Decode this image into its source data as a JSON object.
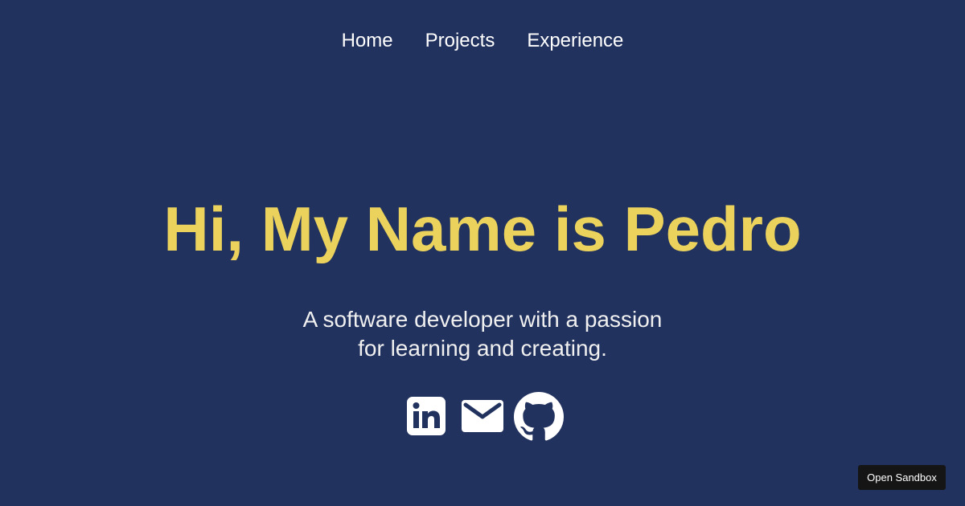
{
  "nav": {
    "items": [
      {
        "label": "Home"
      },
      {
        "label": "Projects"
      },
      {
        "label": "Experience"
      }
    ]
  },
  "hero": {
    "title": "Hi, My Name is Pedro",
    "tagline_line1": "A software developer with a passion",
    "tagline_line2": "for learning and creating."
  },
  "socials": {
    "linkedin_icon": "linkedin-icon",
    "mail_icon": "mail-icon",
    "github_icon": "github-icon"
  },
  "sandbox_button": {
    "label": "Open Sandbox"
  },
  "colors": {
    "background": "#22325e",
    "accent": "#ebd25c",
    "text": "#ffffff",
    "sandbox_button": "#151515"
  }
}
